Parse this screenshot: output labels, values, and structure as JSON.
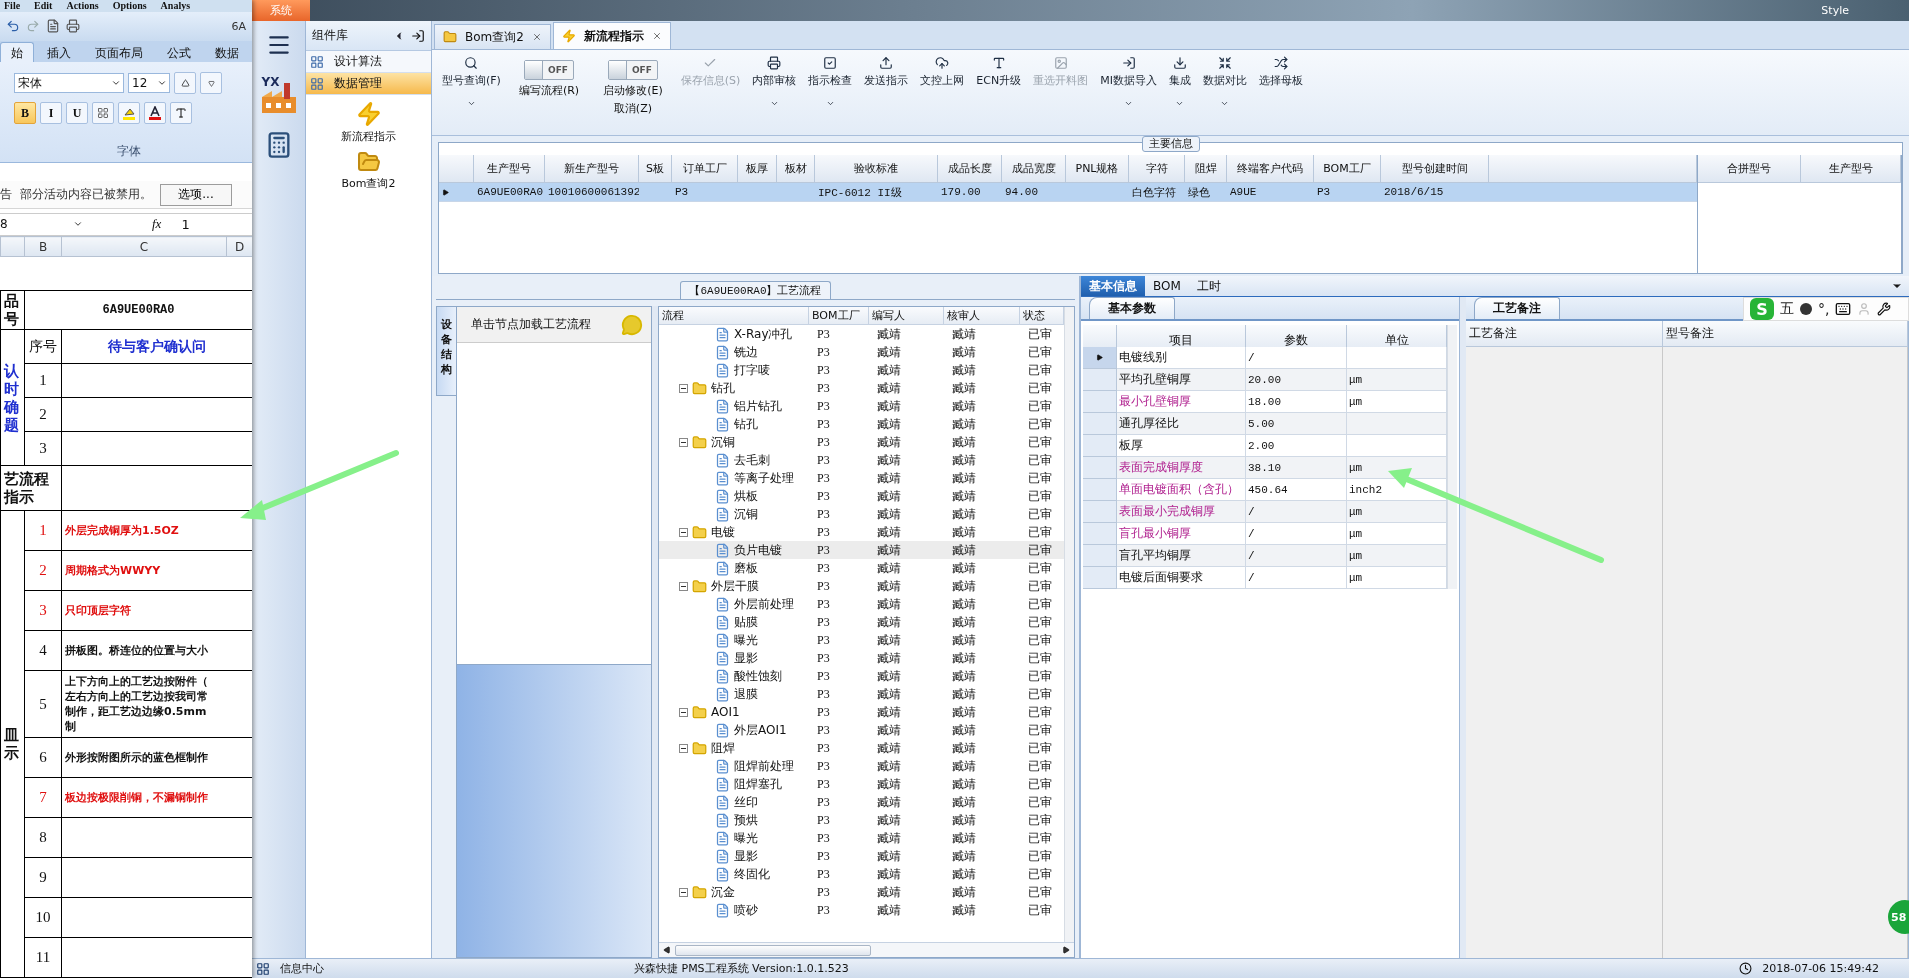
{
  "excel": {
    "menu": [
      "File",
      "Edit",
      "Actions",
      "Options",
      "Analys"
    ],
    "title": "6A",
    "ribbon_tabs": [
      {
        "label": "始",
        "selected": true
      },
      {
        "label": "插入",
        "selected": false
      },
      {
        "label": "页面布局",
        "selected": false
      },
      {
        "label": "公式",
        "selected": false
      },
      {
        "label": "数据",
        "selected": false
      }
    ],
    "font_name": "宋体",
    "font_size": "12",
    "font_group": "字体",
    "format_buttons": [
      {
        "label": "B",
        "on": true
      },
      {
        "label": "I",
        "on": false
      },
      {
        "label": "U",
        "on": false
      }
    ],
    "message": {
      "prefix": "告",
      "text": "部分活动内容已被禁用。",
      "button": "选项..."
    },
    "name_box": "8",
    "formula_label": "fx",
    "formula": "1",
    "columns": [
      "B",
      "C",
      "D"
    ],
    "product_label": "品号",
    "product_no": "6A9UE00RA0",
    "confirm_label": "认时确题",
    "seq_header": "序号",
    "confirm_header": "待与客户确认问",
    "confirm_rows": [
      "1",
      "2",
      "3"
    ],
    "process_label": "艺流程指示",
    "instructions_label": "皿示",
    "instructions": [
      {
        "no": "1",
        "text": "外层完成铜厚为1.5OZ",
        "important": true
      },
      {
        "no": "2",
        "text": "周期格式为WWYY",
        "important": true
      },
      {
        "no": "3",
        "text": "只印顶层字符",
        "important": true
      },
      {
        "no": "4",
        "text": "拼板图。桥连位的位置与大小",
        "important": false
      },
      {
        "no": "5",
        "text": "上下方向上的工艺边按附件（左右方向上的工艺边按我司常制作，距工艺边边缘0.5mm制",
        "important": false
      },
      {
        "no": "6",
        "text": "外形按附图所示的蓝色框制作",
        "important": false
      },
      {
        "no": "7",
        "text": "板边按极限削铜，不漏铜制作",
        "important": true
      },
      {
        "no": "8",
        "important": false
      },
      {
        "no": "9",
        "important": false
      },
      {
        "no": "10",
        "important": false
      },
      {
        "no": "11",
        "important": false
      }
    ]
  },
  "app": {
    "system_tab": "系统",
    "style_label": "Style",
    "rail_logo": "YX",
    "library": {
      "title": "组件库",
      "items": [
        {
          "label": "设计算法",
          "selected": false
        },
        {
          "label": "数据管理",
          "selected": true
        }
      ],
      "tiles": [
        "新流程指示",
        "Bom查询2"
      ]
    },
    "doc_tabs": [
      {
        "label": "Bom查询2",
        "selected": false
      },
      {
        "label": "新流程指示",
        "selected": true
      }
    ],
    "toolbar": [
      {
        "kind": "button",
        "label": "型号查询(F)",
        "menu": true,
        "disabled": false
      },
      {
        "kind": "toggle",
        "label": "编写流程(R)",
        "state_text": "OFF",
        "on": false
      },
      {
        "kind": "toggle",
        "label": "启动修改(E)",
        "sublabel": "取消(Z)",
        "state_text": "OFF",
        "on": false
      },
      {
        "kind": "button",
        "label": "保存信息(S)",
        "menu": false,
        "disabled": true
      },
      {
        "kind": "button",
        "label": "内部审核",
        "menu": true,
        "disabled": false
      },
      {
        "kind": "button",
        "label": "指示检查",
        "menu": true,
        "disabled": false
      },
      {
        "kind": "button",
        "label": "发送指示",
        "menu": false,
        "disabled": false
      },
      {
        "kind": "button",
        "label": "文控上网",
        "menu": false,
        "disabled": false
      },
      {
        "kind": "button",
        "label": "ECN升级",
        "menu": false,
        "disabled": false
      },
      {
        "kind": "button",
        "label": "重选开料图",
        "menu": false,
        "disabled": true
      },
      {
        "kind": "button",
        "label": "MI数据导入",
        "menu": true,
        "disabled": false
      },
      {
        "kind": "button",
        "label": "集成",
        "menu": true,
        "disabled": false
      },
      {
        "kind": "button",
        "label": "数据对比",
        "menu": true,
        "disabled": false
      },
      {
        "kind": "button",
        "label": "选择母板",
        "menu": false,
        "disabled": false
      }
    ],
    "main_info": {
      "title": "主要信息",
      "columns": [
        "生产型号",
        "新生产型号",
        "S板",
        "订单工厂",
        "板厚",
        "板材",
        "验收标准",
        "成品长度",
        "成品宽度",
        "PNL规格",
        "字符",
        "阻焊",
        "终端客户代码",
        "BOM工厂",
        "型号创建时间"
      ],
      "rows": [
        {
          "selected": true,
          "cells": [
            "6A9UE00RA0",
            "10010600061392",
            "",
            "P3",
            "",
            "",
            "IPC-6012 II级",
            "179.00",
            "94.00",
            "",
            "白色字符",
            "绿色",
            "A9UE",
            "P3",
            "2018/6/15"
          ]
        }
      ],
      "side_columns": [
        "合拼型号",
        "生产型号"
      ]
    },
    "flow": {
      "title": "【6A9UE00RA0】工艺流程",
      "side_tab": "设备结构",
      "hint": "单击节点加载工艺流程",
      "columns": [
        "流程",
        "BOM工厂",
        "编写人",
        "核审人",
        "状态"
      ],
      "tree": [
        {
          "kind": "step",
          "name": "X-Ray冲孔",
          "factory": "P3",
          "author": "臧靖",
          "reviewer": "臧靖",
          "status": "已审",
          "selected": false
        },
        {
          "kind": "step",
          "name": "铣边",
          "factory": "P3",
          "author": "臧靖",
          "reviewer": "臧靖",
          "status": "已审",
          "selected": false
        },
        {
          "kind": "step",
          "name": "打字唛",
          "factory": "P3",
          "author": "臧靖",
          "reviewer": "臧靖",
          "status": "已审",
          "selected": false
        },
        {
          "kind": "group",
          "name": "钻孔",
          "factory": "P3",
          "author": "臧靖",
          "reviewer": "臧靖",
          "status": "已审",
          "selected": false,
          "expanded": true,
          "children": [
            {
              "kind": "step",
              "name": "铝片钻孔",
              "factory": "P3",
              "author": "臧靖",
              "reviewer": "臧靖",
              "status": "已审",
              "selected": false
            },
            {
              "kind": "step",
              "name": "钻孔",
              "factory": "P3",
              "author": "臧靖",
              "reviewer": "臧靖",
              "status": "已审",
              "selected": false
            }
          ]
        },
        {
          "kind": "group",
          "name": "沉铜",
          "factory": "P3",
          "author": "臧靖",
          "reviewer": "臧靖",
          "status": "已审",
          "selected": false,
          "expanded": true,
          "children": [
            {
              "kind": "step",
              "name": "去毛刺",
              "factory": "P3",
              "author": "臧靖",
              "reviewer": "臧靖",
              "status": "已审",
              "selected": false
            },
            {
              "kind": "step",
              "name": "等离子处理",
              "factory": "P3",
              "author": "臧靖",
              "reviewer": "臧靖",
              "status": "已审",
              "selected": false
            },
            {
              "kind": "step",
              "name": "烘板",
              "factory": "P3",
              "author": "臧靖",
              "reviewer": "臧靖",
              "status": "已审",
              "selected": false
            },
            {
              "kind": "step",
              "name": "沉铜",
              "factory": "P3",
              "author": "臧靖",
              "reviewer": "臧靖",
              "status": "已审",
              "selected": false
            }
          ]
        },
        {
          "kind": "group",
          "name": "电镀",
          "factory": "P3",
          "author": "臧靖",
          "reviewer": "臧靖",
          "status": "已审",
          "selected": false,
          "expanded": true,
          "children": [
            {
              "kind": "step",
              "name": "负片电镀",
              "factory": "P3",
              "author": "臧靖",
              "reviewer": "臧靖",
              "status": "已审",
              "selected": true
            },
            {
              "kind": "step",
              "name": "磨板",
              "factory": "P3",
              "author": "臧靖",
              "reviewer": "臧靖",
              "status": "已审",
              "selected": false
            }
          ]
        },
        {
          "kind": "group",
          "name": "外层干膜",
          "factory": "P3",
          "author": "臧靖",
          "reviewer": "臧靖",
          "status": "已审",
          "selected": false,
          "expanded": true,
          "children": [
            {
              "kind": "step",
              "name": "外层前处理",
              "factory": "P3",
              "author": "臧靖",
              "reviewer": "臧靖",
              "status": "已审",
              "selected": false
            },
            {
              "kind": "step",
              "name": "贴膜",
              "factory": "P3",
              "author": "臧靖",
              "reviewer": "臧靖",
              "status": "已审",
              "selected": false
            },
            {
              "kind": "step",
              "name": "曝光",
              "factory": "P3",
              "author": "臧靖",
              "reviewer": "臧靖",
              "status": "已审",
              "selected": false
            },
            {
              "kind": "step",
              "name": "显影",
              "factory": "P3",
              "author": "臧靖",
              "reviewer": "臧靖",
              "status": "已审",
              "selected": false
            },
            {
              "kind": "step",
              "name": "酸性蚀刻",
              "factory": "P3",
              "author": "臧靖",
              "reviewer": "臧靖",
              "status": "已审",
              "selected": false
            },
            {
              "kind": "step",
              "name": "退膜",
              "factory": "P3",
              "author": "臧靖",
              "reviewer": "臧靖",
              "status": "已审",
              "selected": false
            }
          ]
        },
        {
          "kind": "group",
          "name": "AOI1",
          "factory": "P3",
          "author": "臧靖",
          "reviewer": "臧靖",
          "status": "已审",
          "selected": false,
          "expanded": true,
          "children": [
            {
              "kind": "step",
              "name": "外层AOI1",
              "factory": "P3",
              "author": "臧靖",
              "reviewer": "臧靖",
              "status": "已审",
              "selected": false
            }
          ]
        },
        {
          "kind": "group",
          "name": "阻焊",
          "factory": "P3",
          "author": "臧靖",
          "reviewer": "臧靖",
          "status": "已审",
          "selected": false,
          "expanded": true,
          "children": [
            {
              "kind": "step",
              "name": "阻焊前处理",
              "factory": "P3",
              "author": "臧靖",
              "reviewer": "臧靖",
              "status": "已审",
              "selected": false
            },
            {
              "kind": "step",
              "name": "阻焊塞孔",
              "factory": "P3",
              "author": "臧靖",
              "reviewer": "臧靖",
              "status": "已审",
              "selected": false
            },
            {
              "kind": "step",
              "name": "丝印",
              "factory": "P3",
              "author": "臧靖",
              "reviewer": "臧靖",
              "status": "已审",
              "selected": false
            },
            {
              "kind": "step",
              "name": "预烘",
              "factory": "P3",
              "author": "臧靖",
              "reviewer": "臧靖",
              "status": "已审",
              "selected": false
            },
            {
              "kind": "step",
              "name": "曝光",
              "factory": "P3",
              "author": "臧靖",
              "reviewer": "臧靖",
              "status": "已审",
              "selected": false
            },
            {
              "kind": "step",
              "name": "显影",
              "factory": "P3",
              "author": "臧靖",
              "reviewer": "臧靖",
              "status": "已审",
              "selected": false
            },
            {
              "kind": "step",
              "name": "终固化",
              "factory": "P3",
              "author": "臧靖",
              "reviewer": "臧靖",
              "status": "已审",
              "selected": false
            }
          ]
        },
        {
          "kind": "group",
          "name": "沉金",
          "factory": "P3",
          "author": "臧靖",
          "reviewer": "臧靖",
          "status": "已审",
          "selected": false,
          "expanded": true,
          "children": [
            {
              "kind": "step",
              "name": "喷砂",
              "factory": "P3",
              "author": "臧靖",
              "reviewer": "臧靖",
              "status": "已审",
              "selected": false
            }
          ]
        }
      ]
    },
    "info_tabs": [
      {
        "label": "基本信息",
        "selected": true
      },
      {
        "label": "BOM",
        "selected": false
      },
      {
        "label": "工时",
        "selected": false
      }
    ],
    "params": {
      "tab": "基本参数",
      "columns": [
        "项目",
        "参数",
        "单位"
      ],
      "rows": [
        {
          "item": "电镀线别",
          "value": "/",
          "unit": "",
          "highlight": false,
          "selected": true
        },
        {
          "item": "平均孔壁铜厚",
          "value": "20.00",
          "unit": "μm",
          "highlight": false,
          "selected": false
        },
        {
          "item": "最小孔壁铜厚",
          "value": "18.00",
          "unit": "μm",
          "highlight": true,
          "selected": false
        },
        {
          "item": "通孔厚径比",
          "value": "5.00",
          "unit": "",
          "highlight": false,
          "selected": false
        },
        {
          "item": "板厚",
          "value": "2.00",
          "unit": "",
          "highlight": false,
          "selected": false
        },
        {
          "item": "表面完成铜厚度",
          "value": "38.10",
          "unit": "μm",
          "highlight": true,
          "selected": false
        },
        {
          "item": "单面电镀面积（含孔）",
          "value": "450.64",
          "unit": "inch2",
          "highlight": true,
          "selected": false
        },
        {
          "item": "表面最小完成铜厚",
          "value": "/",
          "unit": "μm",
          "highlight": true,
          "selected": false
        },
        {
          "item": "盲孔最小铜厚",
          "value": "/",
          "unit": "μm",
          "highlight": true,
          "selected": false
        },
        {
          "item": "盲孔平均铜厚",
          "value": "/",
          "unit": "μm",
          "highlight": false,
          "selected": false
        },
        {
          "item": "电镀后面铜要求",
          "value": "/",
          "unit": "μm",
          "highlight": false,
          "selected": false
        }
      ]
    },
    "notes": {
      "tab": "工艺备注",
      "columns": [
        "工艺备注",
        "型号备注"
      ]
    },
    "ime": {
      "logo": "S",
      "mode": "五",
      "punct": "°,"
    },
    "badge": "58",
    "status_bar": {
      "info": "信息中心",
      "version": "兴森快捷 PMS工程系统 Version:1.0.1.523",
      "time": "2018-07-06 15:49:42"
    }
  }
}
